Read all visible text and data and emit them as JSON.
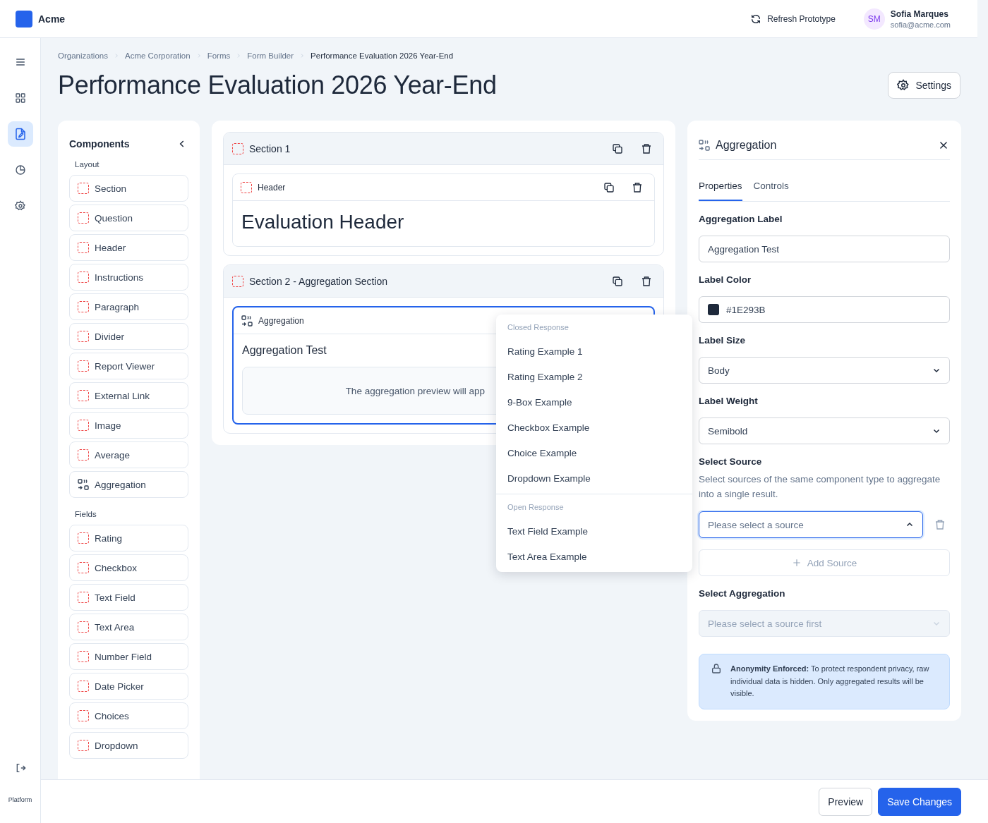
{
  "app": {
    "name": "Acme"
  },
  "header": {
    "refresh_label": "Refresh Prototype",
    "user": {
      "initials": "SM",
      "name": "Sofia Marques",
      "email": "sofia@acme.com"
    }
  },
  "rail": {
    "items": [
      {
        "kind": "menu",
        "selected": false
      },
      {
        "kind": "grid",
        "selected": false
      },
      {
        "kind": "form",
        "selected": true
      },
      {
        "kind": "chart",
        "selected": false
      },
      {
        "kind": "gear",
        "selected": false
      }
    ],
    "footer_label": "Platform"
  },
  "breadcrumbs": [
    "Organizations",
    "Acme Corporation",
    "Forms",
    "Form Builder",
    "Performance Evaluation 2026 Year-End"
  ],
  "title": "Performance Evaluation 2026 Year-End",
  "settings_button": "Settings",
  "components": {
    "title": "Components",
    "groups": [
      {
        "label": "Layout",
        "items": [
          {
            "label": "Section",
            "kind": "block"
          },
          {
            "label": "Question",
            "kind": "block"
          },
          {
            "label": "Header",
            "kind": "block"
          },
          {
            "label": "Instructions",
            "kind": "block"
          },
          {
            "label": "Paragraph",
            "kind": "block"
          },
          {
            "label": "Divider",
            "kind": "block"
          },
          {
            "label": "Report Viewer",
            "kind": "block"
          },
          {
            "label": "External Link",
            "kind": "block"
          },
          {
            "label": "Image",
            "kind": "block"
          },
          {
            "label": "Average",
            "kind": "block"
          },
          {
            "label": "Aggregation",
            "kind": "aggregation"
          }
        ]
      },
      {
        "label": "Fields",
        "items": [
          {
            "label": "Rating",
            "kind": "block"
          },
          {
            "label": "Checkbox",
            "kind": "block"
          },
          {
            "label": "Text Field",
            "kind": "block"
          },
          {
            "label": "Text Area",
            "kind": "block"
          },
          {
            "label": "Number Field",
            "kind": "block"
          },
          {
            "label": "Date Picker",
            "kind": "block"
          },
          {
            "label": "Choices",
            "kind": "block"
          },
          {
            "label": "Dropdown",
            "kind": "block"
          }
        ]
      }
    ]
  },
  "canvas": {
    "sections": [
      {
        "title": "Section 1",
        "children": [
          {
            "kind": "header",
            "type_label": "Header",
            "text": "Evaluation Header",
            "selected": false
          }
        ]
      },
      {
        "title": "Section 2 - Aggregation Section",
        "children": [
          {
            "kind": "aggregation",
            "type_label": "Aggregation",
            "text": "Aggregation Test",
            "preview": "The aggregation preview will app",
            "selected": true
          }
        ]
      }
    ]
  },
  "source_menu": {
    "groups": [
      {
        "label": "Closed Response",
        "options": [
          "Rating Example 1",
          "Rating Example 2",
          "9-Box Example",
          "Checkbox Example",
          "Choice Example",
          "Dropdown Example"
        ]
      },
      {
        "label": "Open Response",
        "options": [
          "Text Field Example",
          "Text Area Example"
        ]
      }
    ]
  },
  "properties": {
    "title": "Aggregation",
    "tabs": [
      {
        "label": "Properties",
        "selected": true
      },
      {
        "label": "Controls",
        "selected": false
      }
    ],
    "fields": [
      {
        "kind": "text",
        "label": "Aggregation Label",
        "value": "Aggregation Test"
      },
      {
        "kind": "color",
        "label": "Label Color",
        "value": "#1E293B",
        "color": "#1e293b"
      },
      {
        "kind": "select",
        "label": "Label Size",
        "value": "Body"
      },
      {
        "kind": "select",
        "label": "Label Weight",
        "value": "Semibold"
      },
      {
        "kind": "source",
        "label": "Select Source",
        "description": "Select sources of the same component type to aggregate into a single result.",
        "placeholder": "Please select a source",
        "open": true,
        "add_label": "Add Source"
      },
      {
        "kind": "disabled_select",
        "label": "Select Aggregation",
        "placeholder": "Please select a source first"
      }
    ],
    "notice": "**Anonymity Enforced:** To protect respondent privacy, raw individual data is hidden. Only aggregated results will be visible."
  },
  "footer_buttons": [
    {
      "label": "Preview",
      "kind": "secondary"
    },
    {
      "label": "Save Changes",
      "kind": "primary"
    }
  ]
}
